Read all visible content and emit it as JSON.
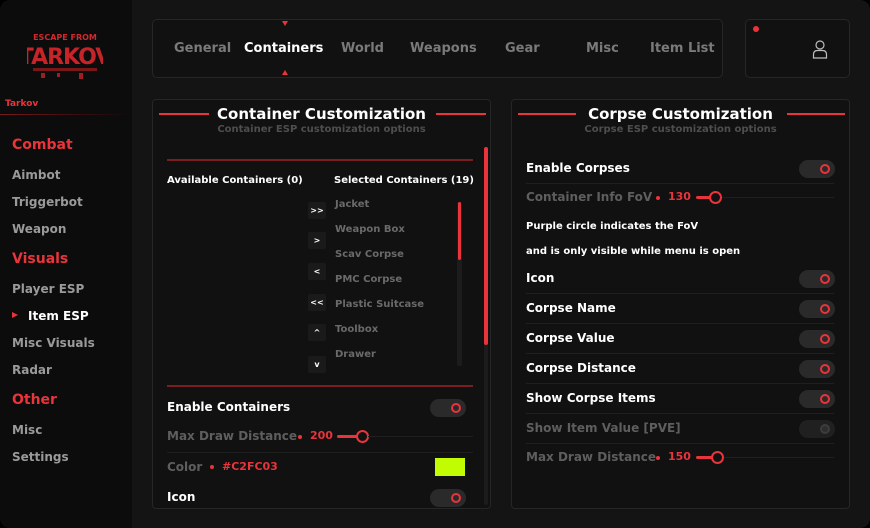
{
  "brand": {
    "game_title": "Tarkov",
    "logo_text_1": "ESCAPE FROM",
    "logo_text_2": "TARKOV"
  },
  "sidebar": {
    "sections": [
      {
        "heading": "Combat",
        "items": [
          "Aimbot",
          "Triggerbot",
          "Weapon"
        ]
      },
      {
        "heading": "Visuals",
        "items": [
          "Player ESP",
          "Item ESP",
          "Misc Visuals",
          "Radar"
        ]
      },
      {
        "heading": "Other",
        "items": [
          "Misc",
          "Settings"
        ]
      }
    ],
    "active_item": "Item ESP"
  },
  "tabs": [
    "General",
    "Containers",
    "World",
    "Weapons",
    "Gear",
    "Misc",
    "Item List"
  ],
  "active_tab": "Containers",
  "container_panel": {
    "title": "Container Customization",
    "subtitle": "Container ESP customization options",
    "available_header": "Available Containers (0)",
    "selected_header": "Selected Containers (19)",
    "transfer_buttons": [
      ">>",
      ">",
      "<",
      "<<",
      "^",
      "v"
    ],
    "selected_items": [
      "Jacket",
      "Weapon Box",
      "Scav Corpse",
      "PMC Corpse",
      "Plastic Suitcase",
      "Toolbox",
      "Drawer"
    ],
    "enable_label": "Enable Containers",
    "enable_on": true,
    "max_distance_label": "Max Draw Distance",
    "max_distance_value": "200",
    "color_label": "Color",
    "color_value": "#C2FC03",
    "icon_label": "Icon",
    "icon_on": true
  },
  "corpse_panel": {
    "title": "Corpse Customization",
    "subtitle": "Corpse ESP customization options",
    "enable_label": "Enable Corpses",
    "enable_on": true,
    "fov_label": "Container Info FoV",
    "fov_value": "130",
    "note_1": "Purple circle indicates the FoV",
    "note_2": "and is only visible while menu is open",
    "icon_label": "Icon",
    "name_label": "Corpse Name",
    "value_label": "Corpse Value",
    "distance_label": "Corpse Distance",
    "items_label": "Show Corpse Items",
    "item_value_label": "Show Item Value [PVE]",
    "item_value_on": false,
    "max_distance_label": "Max Draw Distance",
    "max_distance_value": "150"
  },
  "colors": {
    "accent": "#e8343a",
    "background": "#141414",
    "sidebar": "#0c0c0c",
    "swatch": "#C2FC03"
  },
  "icons": {
    "user": "user-icon"
  }
}
